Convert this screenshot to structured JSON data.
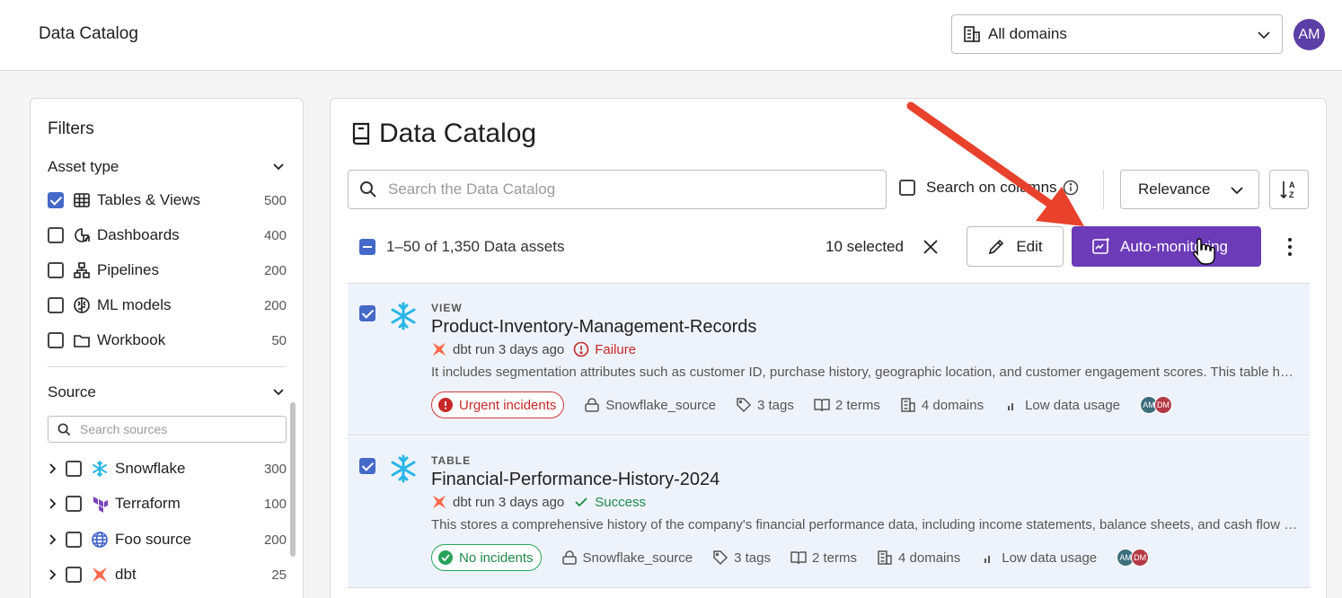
{
  "topbar": {
    "title": "Data Catalog",
    "domain_select": {
      "value": "All domains",
      "icon": "building-icon"
    },
    "avatar": "AM"
  },
  "filters": {
    "title": "Filters",
    "asset_type": {
      "heading": "Asset type",
      "items": [
        {
          "label": "Tables & Views",
          "count": "500",
          "checked": true,
          "icon": "table-icon"
        },
        {
          "label": "Dashboards",
          "count": "400",
          "checked": false,
          "icon": "dashboard-icon"
        },
        {
          "label": "Pipelines",
          "count": "200",
          "checked": false,
          "icon": "pipeline-icon"
        },
        {
          "label": "ML models",
          "count": "200",
          "checked": false,
          "icon": "brain-icon"
        },
        {
          "label": "Workbook",
          "count": "50",
          "checked": false,
          "icon": "folder-icon"
        }
      ]
    },
    "source": {
      "heading": "Source",
      "search_placeholder": "Search sources",
      "items": [
        {
          "label": "Snowflake",
          "count": "300",
          "icon": "snowflake-icon"
        },
        {
          "label": "Terraform",
          "count": "100",
          "icon": "terraform-icon"
        },
        {
          "label": "Foo source",
          "count": "200",
          "icon": "globe-icon"
        },
        {
          "label": "dbt",
          "count": "25",
          "icon": "dbt-icon"
        }
      ]
    }
  },
  "main": {
    "title": "Data Catalog",
    "search_placeholder": "Search the Data Catalog",
    "search_on_columns": "Search on columns",
    "sort": "Relevance",
    "count_text": "1–50 of 1,350 Data assets",
    "selected_text": "10 selected",
    "edit_label": "Edit",
    "auto_monitoring_label": "Auto-monitoring",
    "cards": [
      {
        "type": "VIEW",
        "name": "Product-Inventory-Management-Records",
        "run": "dbt run 3 days ago",
        "status": "Failure",
        "description": "It includes segmentation attributes such as customer ID, purchase history, geographic location, and customer engagement scores. This table helps in understanding customer behaviour and preferences.",
        "incidents": "Urgent incidents",
        "source": "Snowflake_source",
        "tags": "3 tags",
        "terms": "2 terms",
        "domains": "4 domains",
        "usage": "Low data usage",
        "owners": [
          "AM",
          "DM"
        ]
      },
      {
        "type": "TABLE",
        "name": "Financial-Performance-History-2024",
        "run": "dbt run 3 days ago",
        "status": "Success",
        "description": "This stores a comprehensive history of the company's financial performance data, including income statements, balance sheets, and cash flow statements.",
        "incidents": "No incidents",
        "source": "Snowflake_source",
        "tags": "3 tags",
        "terms": "2 terms",
        "domains": "4 domains",
        "usage": "Low data usage",
        "owners": [
          "AM",
          "DM"
        ]
      }
    ]
  },
  "colors": {
    "accent": "#6b3bb8",
    "checkbox": "#4469c8",
    "failure": "#c62828",
    "success": "#1e8a47",
    "arrow": "#e8412c"
  }
}
